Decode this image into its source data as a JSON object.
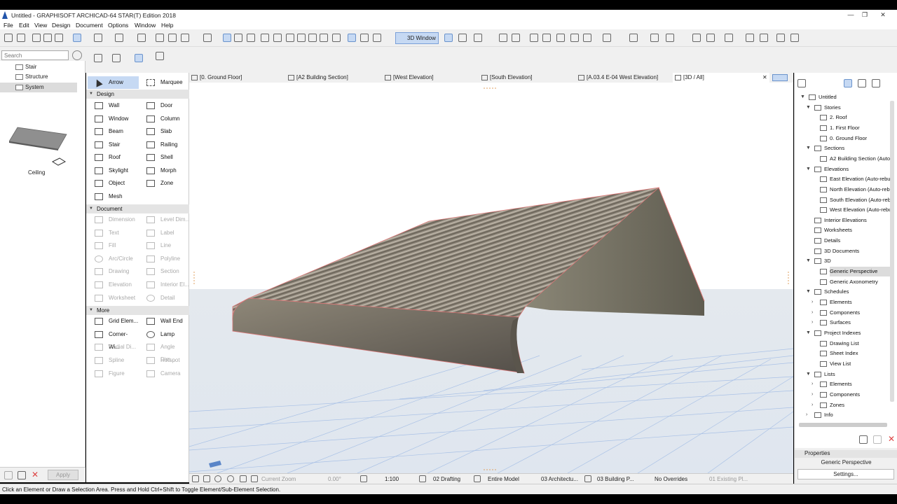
{
  "window": {
    "title": "Untitled - GRAPHISOFT ARCHICAD-64 STAR(T) Edition 2018",
    "controls": [
      "—",
      "❐",
      "✕"
    ]
  },
  "menu": [
    "File",
    "Edit",
    "View",
    "Design",
    "Document",
    "Options",
    "Window",
    "Help"
  ],
  "toolbar": {
    "window_3d_label": "3D Window"
  },
  "search": {
    "placeholder": "Search"
  },
  "library_tree": [
    {
      "label": "Stair"
    },
    {
      "label": "Structure"
    },
    {
      "label": "System",
      "selected": true
    }
  ],
  "preview": {
    "label": "Ceiling"
  },
  "bottom_left": {
    "apply_label": "Apply"
  },
  "toolbox": {
    "top": [
      {
        "label": "Arrow",
        "selected": true
      },
      {
        "label": "Marquee"
      }
    ],
    "sections": [
      {
        "title": "Design",
        "tools": [
          "Wall",
          "Door",
          "Window",
          "Column",
          "Beam",
          "Slab",
          "Stair",
          "Railing",
          "Roof",
          "Shell",
          "Skylight",
          "Morph",
          "Object",
          "Zone",
          "Mesh"
        ]
      },
      {
        "title": "Document",
        "disabled": true,
        "tools": [
          "Dimension",
          "Level Dim...",
          "Text",
          "Label",
          "Fill",
          "Line",
          "Arc/Circle",
          "Polyline",
          "Drawing",
          "Section",
          "Elevation",
          "Interior El...",
          "Worksheet",
          "Detail"
        ]
      },
      {
        "title": "More",
        "tools": [
          "Grid Elem...",
          "Wall End",
          "Corner-Wi...",
          "Lamp",
          "Radial Di...",
          "Angle Dim...",
          "Spline",
          "Hotspot",
          "Figure",
          "Camera"
        ],
        "disabled_tools": [
          "Radial Di...",
          "Angle Dim...",
          "Spline",
          "Hotspot",
          "Figure",
          "Camera"
        ]
      }
    ]
  },
  "tabs": [
    {
      "label": "[0. Ground Floor]"
    },
    {
      "label": "[A2 Building Section]"
    },
    {
      "label": "[West Elevation]"
    },
    {
      "label": "[South Elevation]"
    },
    {
      "label": "[A.03.4 E-04 West Elevation]"
    },
    {
      "label": "[3D / All]",
      "active": true
    }
  ],
  "tab_close": "✕",
  "statusbar": {
    "zoom": "Current Zoom",
    "angle": "0.00°",
    "scale": "1:100",
    "layer": "02 Drafting",
    "model": "Entire Model",
    "pen": "03 Architectu...",
    "mvo": "03 Building P...",
    "overrides": "No Overrides",
    "phase": "01 Existing Pl..."
  },
  "message": "Click an Element or Draw a Selection Area. Press and Hold Ctrl+Shift to Toggle Element/Sub-Element Selection.",
  "navigator": {
    "items": [
      {
        "label": "Untitled",
        "level": 0,
        "toggle": "▼"
      },
      {
        "label": "Stories",
        "level": 1,
        "toggle": "▼"
      },
      {
        "label": "2. Roof",
        "level": 2
      },
      {
        "label": "1. First Floor",
        "level": 2
      },
      {
        "label": "0. Ground Floor",
        "level": 2
      },
      {
        "label": "Sections",
        "level": 1,
        "toggle": "▼"
      },
      {
        "label": "A2 Building Section (Auto-r",
        "level": 2
      },
      {
        "label": "Elevations",
        "level": 1,
        "toggle": "▼"
      },
      {
        "label": "East Elevation (Auto-rebuil",
        "level": 2
      },
      {
        "label": "North Elevation (Auto-rebu",
        "level": 2
      },
      {
        "label": "South Elevation (Auto-rebu",
        "level": 2
      },
      {
        "label": "West Elevation (Auto-rebui",
        "level": 2
      },
      {
        "label": "Interior Elevations",
        "level": 1
      },
      {
        "label": "Worksheets",
        "level": 1
      },
      {
        "label": "Details",
        "level": 1
      },
      {
        "label": "3D Documents",
        "level": 1
      },
      {
        "label": "3D",
        "level": 1,
        "toggle": "▼"
      },
      {
        "label": "Generic Perspective",
        "level": 2,
        "selected": true
      },
      {
        "label": "Generic Axonometry",
        "level": 2
      },
      {
        "label": "Schedules",
        "level": 1,
        "toggle": "▼"
      },
      {
        "label": "Elements",
        "level": 2,
        "toggle": "›"
      },
      {
        "label": "Components",
        "level": 2,
        "toggle": "›"
      },
      {
        "label": "Surfaces",
        "level": 2,
        "toggle": "›"
      },
      {
        "label": "Project Indexes",
        "level": 1,
        "toggle": "▼"
      },
      {
        "label": "Drawing List",
        "level": 2
      },
      {
        "label": "Sheet Index",
        "level": 2
      },
      {
        "label": "View List",
        "level": 2
      },
      {
        "label": "Lists",
        "level": 1,
        "toggle": "▼"
      },
      {
        "label": "Elements",
        "level": 2,
        "toggle": "›"
      },
      {
        "label": "Components",
        "level": 2,
        "toggle": "›"
      },
      {
        "label": "Zones",
        "level": 2,
        "toggle": "›"
      },
      {
        "label": "Info",
        "level": 1,
        "toggle": "›"
      }
    ]
  },
  "properties": {
    "header": "Properties",
    "name": "Generic Perspective",
    "settings_label": "Settings..."
  },
  "colors": {
    "accent": "#c6d9f3",
    "selection": "#dcdcdc",
    "roof": "#7d7567",
    "grid": "#a9c1e6"
  }
}
